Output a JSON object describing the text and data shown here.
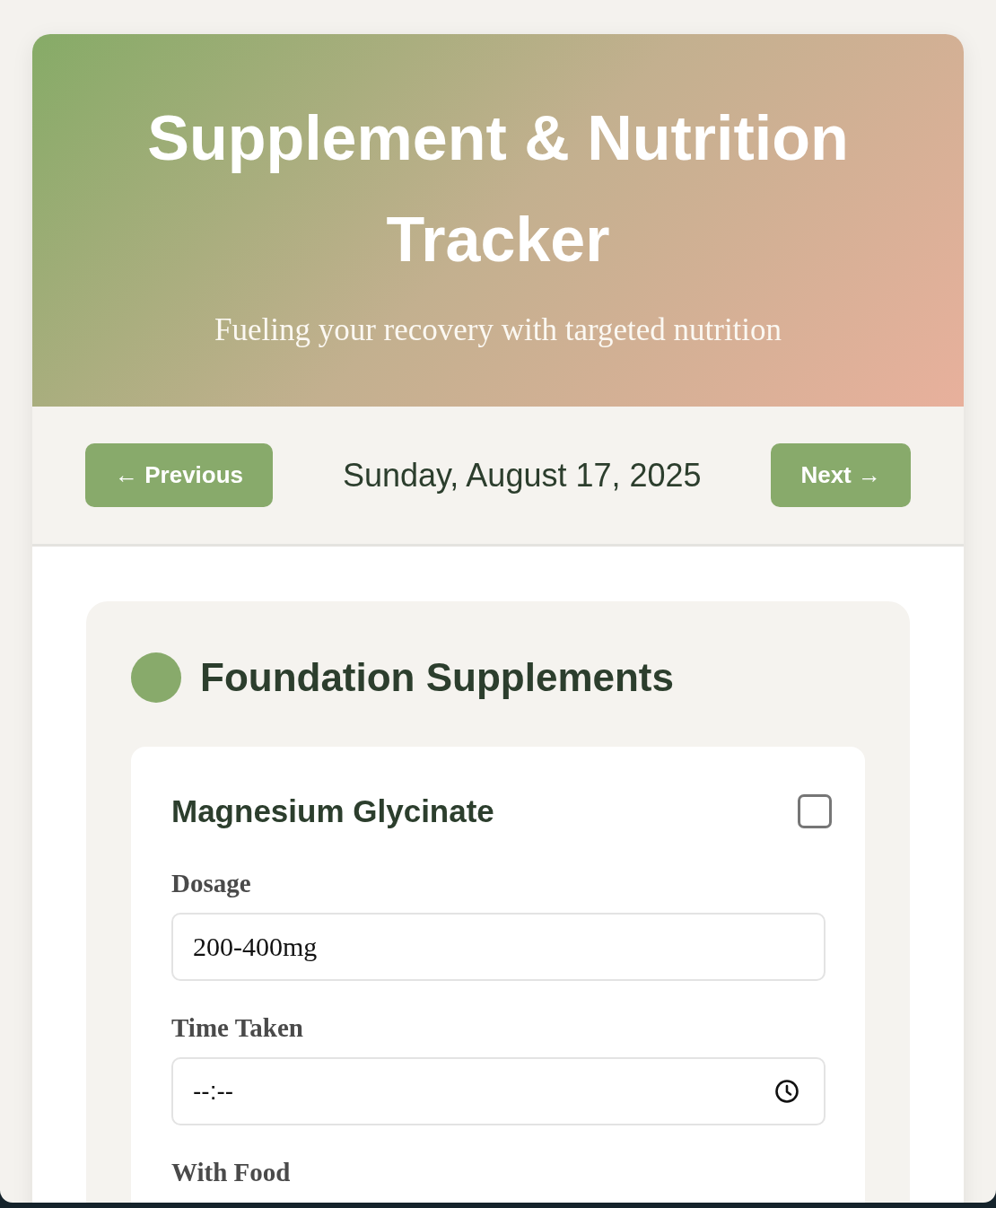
{
  "header": {
    "title": "Supplement & Nutrition Tracker",
    "subtitle": "Fueling your recovery with targeted nutrition"
  },
  "date_nav": {
    "previous": "← Previous",
    "date": "Sunday, August 17, 2025",
    "next": "Next →"
  },
  "sections": [
    {
      "title": "Foundation Supplements",
      "color": "#88aa6b",
      "items": [
        {
          "name": "Magnesium Glycinate",
          "checked": false,
          "fields": [
            {
              "kind": "text",
              "label": "Dosage",
              "value": "200-400mg"
            },
            {
              "kind": "time",
              "label": "Time Taken",
              "placeholder": "--:--"
            },
            {
              "label": "With Food"
            }
          ]
        }
      ]
    }
  ]
}
